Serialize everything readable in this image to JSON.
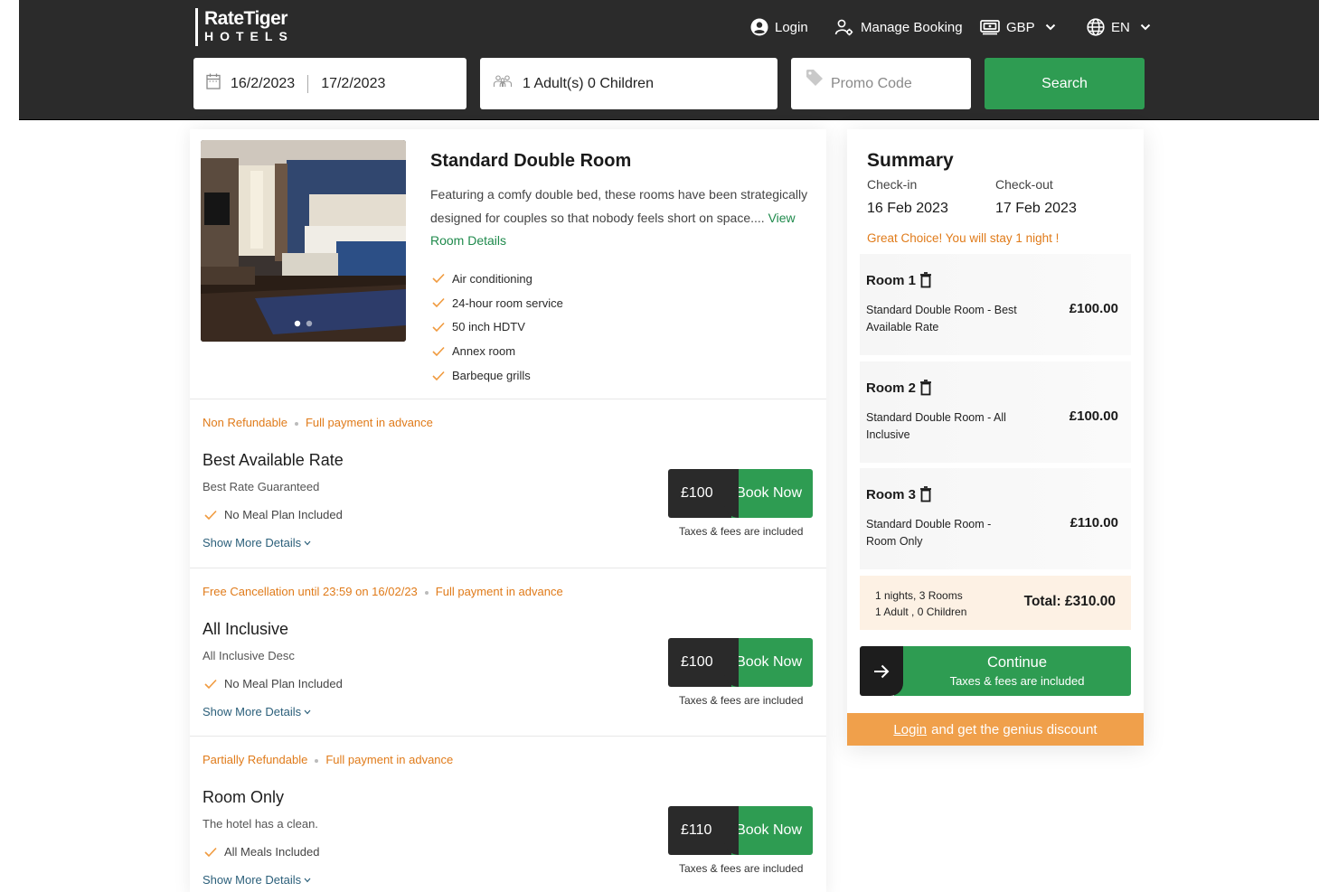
{
  "brand": {
    "line1": "RateTiger",
    "line2": "HOTELS"
  },
  "topnav": {
    "login": "Login",
    "manage_booking": "Manage Booking",
    "currency": "GBP",
    "language": "EN"
  },
  "search": {
    "check_in": "16/2/2023",
    "check_out": "17/2/2023",
    "guests": "1 Adult(s) 0 Children",
    "promo_placeholder": "Promo Code",
    "search_label": "Search"
  },
  "room": {
    "title": "Standard Double Room",
    "description": "Featuring a comfy double bed, these rooms have been strategically designed for couples so that nobody feels short on space....",
    "view_details": "View Room Details",
    "amenities": [
      "Air conditioning",
      "24-hour room service",
      "50 inch HDTV",
      "Annex room",
      "Barbeque grills"
    ]
  },
  "rates": [
    {
      "policy": "Non Refundable",
      "payment": "Full payment in advance",
      "name": "Best Available Rate",
      "subtitle": "Best Rate Guaranteed",
      "meal": "No Meal Plan Included",
      "more": "Show More Details",
      "price": "£100",
      "book": "Book Now",
      "taxes": "Taxes & fees are included"
    },
    {
      "policy": "Free Cancellation until 23:59 on 16/02/23",
      "payment": "Full payment in advance",
      "name": "All Inclusive",
      "subtitle": "All Inclusive Desc",
      "meal": "No Meal Plan Included",
      "more": "Show More Details",
      "price": "£100",
      "book": "Book Now",
      "taxes": "Taxes & fees are included"
    },
    {
      "policy": "Partially Refundable",
      "payment": "Full payment in advance",
      "name": "Room Only",
      "subtitle": "The hotel has a clean.",
      "meal": "All Meals Included",
      "more": "Show More Details",
      "price": "£110",
      "book": "Book Now",
      "taxes": "Taxes & fees are included"
    }
  ],
  "summary": {
    "title": "Summary",
    "check_in_label": "Check-in",
    "check_out_label": "Check-out",
    "check_in": "16 Feb 2023",
    "check_out": "17 Feb 2023",
    "stay_note": "Great Choice! You will stay 1 night !",
    "rooms": [
      {
        "label": "Room 1",
        "desc": "Standard Double Room - Best Available Rate",
        "price": "£100.00"
      },
      {
        "label": "Room 2",
        "desc": "Standard Double Room - All Inclusive",
        "price": "£100.00"
      },
      {
        "label": "Room 3",
        "desc": "Standard Double Room - Room Only",
        "price": "£110.00"
      }
    ],
    "nights_rooms": "1 nights, 3 Rooms",
    "guests": "1 Adult , 0 Children",
    "total": "Total: £310.00",
    "continue": "Continue",
    "continue_sub": "Taxes & fees are included",
    "genius_login": "Login",
    "genius_text": "and get the genius discount"
  },
  "colors": {
    "header_bg": "#2b2b2b",
    "accent_green": "#2e9c52",
    "accent_orange": "#e07b1a",
    "genius_bg": "#f0a04b"
  }
}
